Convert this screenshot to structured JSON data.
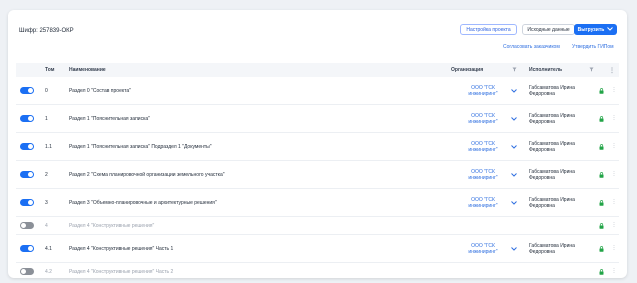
{
  "header": {
    "code": "Шифр: 257839-ОКР",
    "settings_button": "Настройка проекта",
    "source_button": "Исходные данные",
    "export_button": "Выгрузить",
    "link_customer": "Согласовать заказчиком",
    "link_gip": "Утвердить ГИПом"
  },
  "table": {
    "columns": {
      "tom": "Том",
      "name": "Наименование",
      "org": "Организация",
      "exec": "Исполнитель"
    },
    "rows": [
      {
        "enabled": true,
        "num": "0",
        "name": "Раздел 0 \"Состав проекта\"",
        "org": "ООО \"ГСК инжиниринг\"",
        "exec": "Габсаматова Ирина Федоровна"
      },
      {
        "enabled": true,
        "num": "1",
        "name": "Раздел 1 \"Пояснительная записка\"",
        "org": "ООО \"ГСК инжиниринг\"",
        "exec": "Габсаматова Ирина Федоровна"
      },
      {
        "enabled": true,
        "num": "1.1",
        "name": "Раздел 1 \"Пояснительная записка\" Подраздел 1 \"Документы\"",
        "org": "ООО \"ГСК инжиниринг\"",
        "exec": "Габсаматова Ирина Федоровна"
      },
      {
        "enabled": true,
        "num": "2",
        "name": "Раздел 2 \"Схема планировочной организации земельного участка\"",
        "org": "ООО \"ГСК инжиниринг\"",
        "exec": "Габсаматова Ирина Федоровна"
      },
      {
        "enabled": true,
        "num": "3",
        "name": "Раздел 3 \"Объемно-планировочные и архитектурные решения\"",
        "org": "ООО \"ГСК инжиниринг\"",
        "exec": "Габсаматова Ирина Федоровна"
      },
      {
        "enabled": false,
        "num": "4",
        "name": "Раздел 4 \"Конструктивные решения\"",
        "org": "",
        "exec": ""
      },
      {
        "enabled": true,
        "num": "4.1",
        "name": "Раздел 4 \"Конструктивные решения\" Часть 1",
        "org": "ООО \"ГСК инжиниринг\"",
        "exec": "Габсаматова Ирина Федоровна"
      },
      {
        "enabled": false,
        "num": "4.2",
        "name": "Раздел 4 \"Конструктивные решения\" Часть 2",
        "org": "",
        "exec": ""
      }
    ]
  },
  "colors": {
    "accent": "#1b6ff3",
    "link": "#2f6fe0",
    "lock": "#22a447",
    "toggle_off": "#8b9098"
  },
  "icons": {
    "filter": "filter-icon",
    "chevron": "chevron-down-icon",
    "lock": "lock-icon",
    "more": "more-vertical-icon",
    "grip": "drag-handle-icon"
  }
}
